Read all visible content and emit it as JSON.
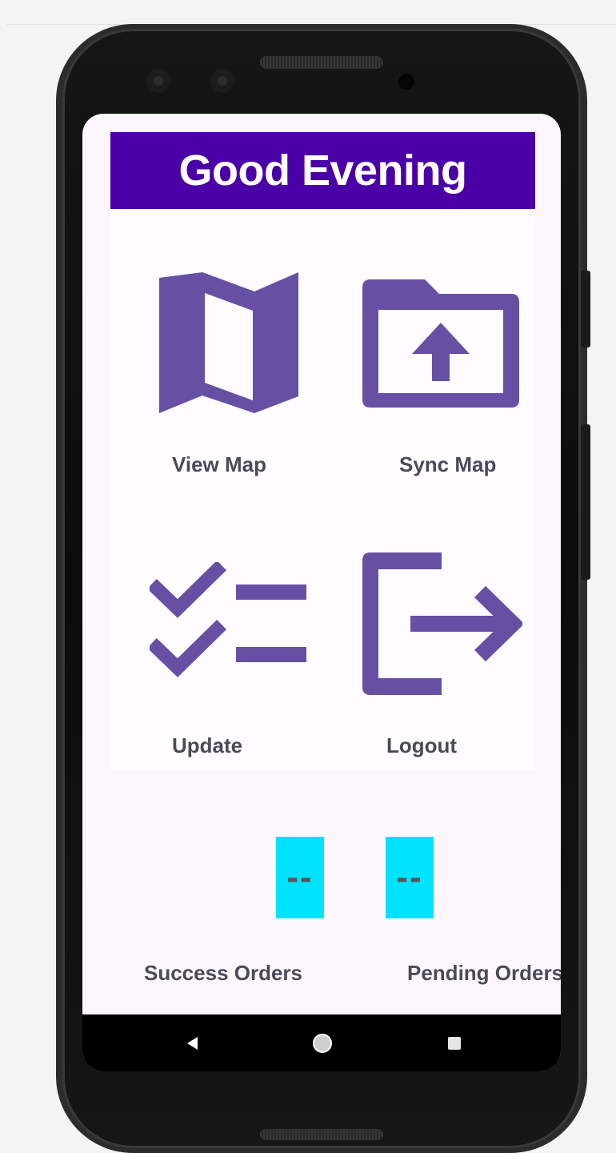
{
  "header": {
    "greeting": "Good Evening"
  },
  "menu": {
    "view_map": "View Map",
    "sync_map": "Sync Map",
    "update": "Update",
    "logout": "Logout"
  },
  "stats": {
    "success_label": "Success Orders",
    "success_value": "--",
    "pending_label": "Pending Orders",
    "pending_value": "--"
  },
  "icons": {
    "view_map": "map-icon",
    "sync_map": "folder-upload-icon",
    "update": "checklist-icon",
    "logout": "logout-icon",
    "back": "back-triangle-icon",
    "home": "home-circle-icon",
    "recents": "recents-square-icon"
  },
  "colors": {
    "header_bg": "#4a00a6",
    "icon": "#6750a4",
    "label": "#4b4a58",
    "count_box": "#00e3ff",
    "screen_bg": "#fcf7fd"
  }
}
